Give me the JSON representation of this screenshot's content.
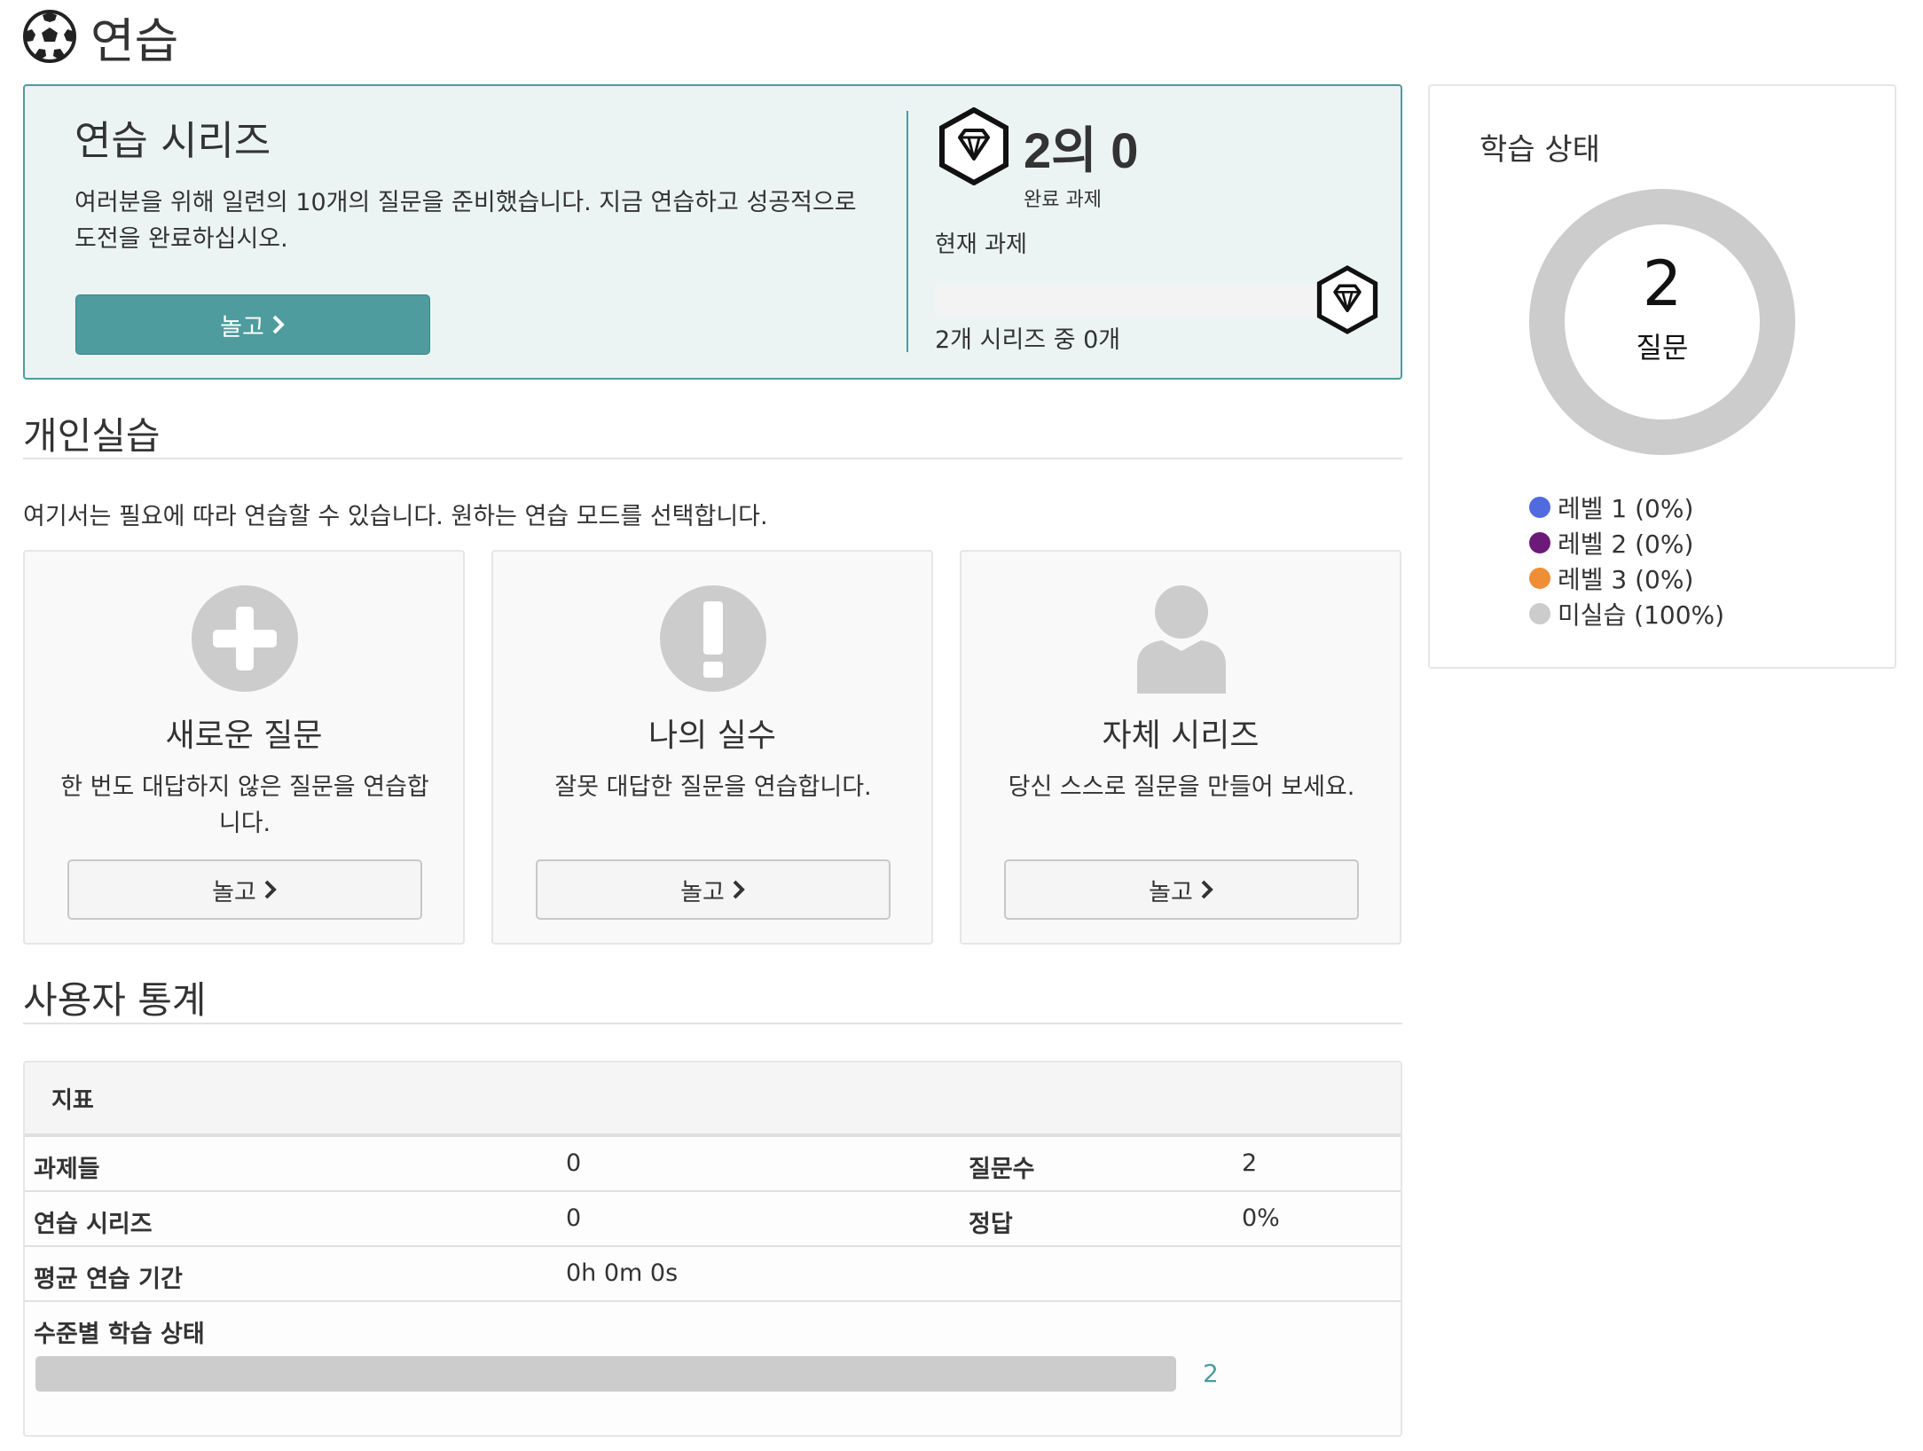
{
  "page": {
    "title": "연습"
  },
  "series": {
    "title": "연습 시리즈",
    "description": "여러분을 위해 일련의 10개의 질문을 준비했습니다. 지금 연습하고 성공적으로 도전을 완료하십시오.",
    "play_label": "놀고",
    "score": "2의 0",
    "score_caption": "완료 과제",
    "current_task_label": "현재 과제",
    "progress_text": "2개 시리즈 중 0개",
    "progress_fraction": 0
  },
  "status_panel": {
    "title": "학습 상태",
    "total": "2",
    "total_label": "질문",
    "legend": [
      {
        "label": "레벨 1 (0%)",
        "color": "#4f6bde"
      },
      {
        "label": "레벨 2 (0%)",
        "color": "#6c1a78"
      },
      {
        "label": "레벨 3 (0%)",
        "color": "#f08e35"
      },
      {
        "label": "미실습 (100%)",
        "color": "#cccccc"
      }
    ]
  },
  "individual": {
    "heading": "개인실습",
    "description": "여기서는 필요에 따라 연습할 수 있습니다. 원하는 연습 모드를 선택합니다.",
    "modes": [
      {
        "icon": "plus-circle-icon",
        "title": "새로운 질문",
        "description": "한 번도 대답하지 않은 질문을 연습합니다.",
        "button": "놀고"
      },
      {
        "icon": "exclamation-circle-icon",
        "title": "나의 실수",
        "description": "잘못 대답한 질문을 연습합니다.",
        "button": "놀고"
      },
      {
        "icon": "user-icon",
        "title": "자체 시리즈",
        "description": "당신 스스로 질문을 만들어 보세요.",
        "button": "놀고"
      }
    ]
  },
  "stats": {
    "heading": "사용자 통계",
    "table_header": "지표",
    "rows": [
      {
        "label": "과제들",
        "value": "0",
        "label2": "질문수",
        "value2": "2"
      },
      {
        "label": "연습 시리즈",
        "value": "0",
        "label2": "정답",
        "value2": "0%"
      },
      {
        "label": "평균 연습 기간",
        "value": "0h 0m 0s"
      }
    ],
    "level_label": "수준별 학습 상태",
    "level_count": "2"
  },
  "colors": {
    "accent": "#4e9c9d",
    "donut": "#cccccc"
  }
}
